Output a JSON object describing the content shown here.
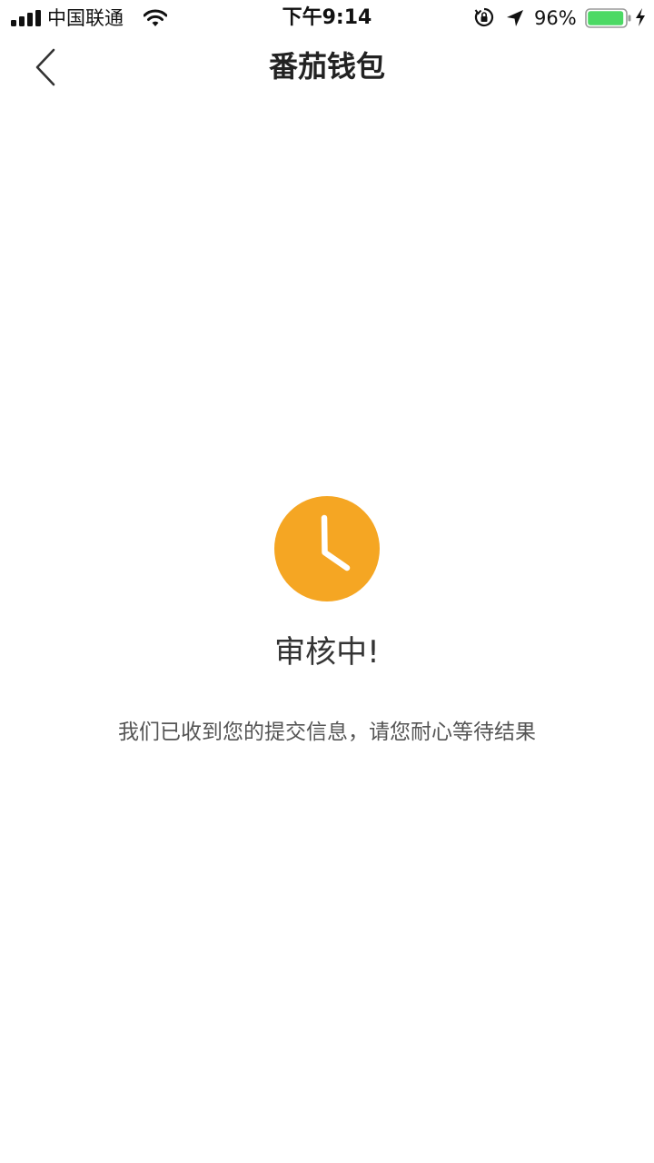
{
  "status_bar": {
    "carrier": "中国联通",
    "time": "下午9:14",
    "battery_percent": "96%",
    "battery_level": 0.96,
    "icons": [
      "signal-icon",
      "wifi-icon",
      "orientation-lock-icon",
      "location-icon",
      "battery-icon",
      "charging-icon"
    ]
  },
  "nav": {
    "title": "番茄钱包",
    "back_icon": "chevron-left-icon"
  },
  "review": {
    "icon": "clock-icon",
    "title": "审核中!",
    "description": "我们已收到您的提交信息，请您耐心等待结果"
  },
  "colors": {
    "accent": "#F5A623",
    "battery_fill": "#4CD964",
    "text_primary": "#333333",
    "text_secondary": "#555555"
  }
}
